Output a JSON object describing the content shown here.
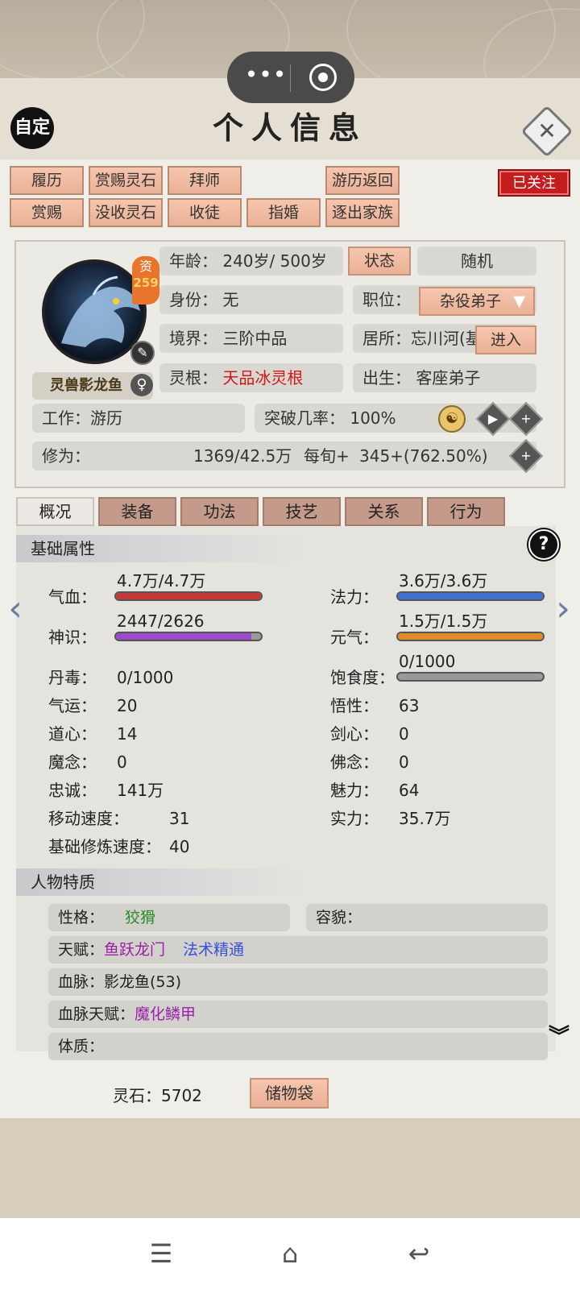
{
  "header": {
    "title": "个人信息",
    "auto_label": "自定",
    "capsule_more": "•••"
  },
  "top_buttons": {
    "row1": [
      "履历",
      "赏赐灵石",
      "拜师",
      "游历返回"
    ],
    "row2": [
      "赏赐",
      "没收灵石",
      "收徒",
      "指婚",
      "逐出家族"
    ],
    "follow": "已关注"
  },
  "profile": {
    "aptitude_label": "资",
    "aptitude_value": "259",
    "avatar_name": "灵兽影龙鱼",
    "gender": "♀",
    "age_label": "年龄：",
    "age_value": "240岁/ 500岁",
    "status_btn": "状态",
    "random_btn": "随机",
    "identity_label": "身份：",
    "identity_value": "无",
    "position_label": "职位：",
    "position_value": "杂役弟子",
    "realm_label": "境界：",
    "realm_value": "三阶中品",
    "residence_label": "居所：",
    "residence_value": "忘川河(基",
    "enter_btn": "进入",
    "root_label": "灵根：",
    "root_value": "天品冰灵根",
    "birth_label": "出生：",
    "birth_value": "客座弟子",
    "work_label": "工作：",
    "work_value": "游历",
    "breakthrough_label": "突破几率：",
    "breakthrough_value": "100%",
    "cultivation_label": "修为：",
    "cultivation_value": "1369/42.5万",
    "per_turn_label": "每旬+",
    "per_turn_value": "345+(762.50%)"
  },
  "tabs": [
    "概况",
    "装备",
    "功法",
    "技艺",
    "关系",
    "行为"
  ],
  "basic": {
    "heading": "基础属性",
    "help": "?",
    "hp": {
      "label": "气血：",
      "value": "4.7万/4.7万",
      "ratio": 1.0,
      "color": "#c43a3a"
    },
    "mana": {
      "label": "法力：",
      "value": "3.6万/3.6万",
      "ratio": 1.0,
      "color": "#3f6fd1"
    },
    "sense": {
      "label": "神识：",
      "value": "2447/2626",
      "ratio": 0.932,
      "color": "#9a4cc9"
    },
    "vigor": {
      "label": "元气：",
      "value": "1.5万/1.5万",
      "ratio": 1.0,
      "color": "#e08a30"
    },
    "satiety": {
      "label": "饱食度：",
      "value": "0/1000",
      "ratio": 0.0,
      "color": "#8a8a8a"
    },
    "left_stats": [
      {
        "label": "丹毒：",
        "value": "0/1000"
      },
      {
        "label": "气运：",
        "value": "20"
      },
      {
        "label": "道心：",
        "value": "14"
      },
      {
        "label": "魔念：",
        "value": "0"
      },
      {
        "label": "忠诚：",
        "value": "141万"
      },
      {
        "label": "移动速度：",
        "value": "31"
      },
      {
        "label": "基础修炼速度：",
        "value": "40"
      }
    ],
    "right_stats": [
      {
        "label": "悟性：",
        "value": "63"
      },
      {
        "label": "剑心：",
        "value": "0"
      },
      {
        "label": "佛念：",
        "value": "0"
      },
      {
        "label": "魅力：",
        "value": "64"
      },
      {
        "label": "实力：",
        "value": "35.7万"
      }
    ]
  },
  "traits": {
    "heading": "人物特质",
    "personality_label": "性格：",
    "personality_value": "狡猾",
    "looks_label": "容貌：",
    "talent_label": "天赋：",
    "talent_1": "鱼跃龙门",
    "talent_2": "法术精通",
    "bloodline_label": "血脉：",
    "bloodline_value": "影龙鱼(53)",
    "bloodline_talent_label": "血脉天赋：",
    "bloodline_talent_value": "魔化鳞甲",
    "physique_label": "体质："
  },
  "footer": {
    "stone_label": "灵石：5702",
    "bag_btn": "储物袋"
  },
  "nav": {
    "menu": "☰",
    "home": "⌂",
    "back": "↩"
  }
}
